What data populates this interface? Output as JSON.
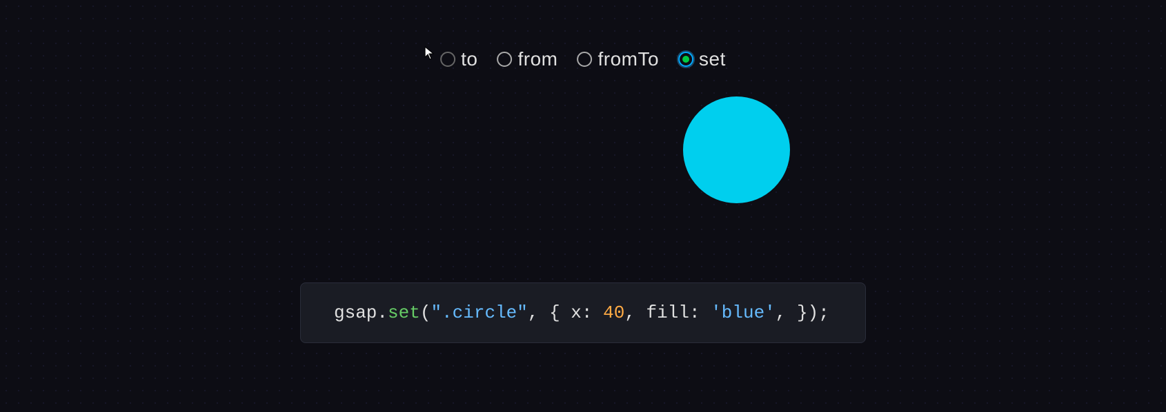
{
  "radio_group": {
    "options": [
      {
        "id": "to",
        "label": "to",
        "state": "cursor-hover"
      },
      {
        "id": "from",
        "label": "from",
        "state": "unchecked"
      },
      {
        "id": "fromTo",
        "label": "fromTo",
        "state": "unchecked"
      },
      {
        "id": "set",
        "label": "set",
        "state": "selected"
      }
    ]
  },
  "circle": {
    "color": "#00cfee",
    "size": 155
  },
  "code": {
    "object": "gsap",
    "method": "set",
    "selector": ".circle",
    "params": "{ x: 40, fill: 'blue', }",
    "full_line": "gsap.set(\".circle\", { x: 40, fill: 'blue', });"
  }
}
